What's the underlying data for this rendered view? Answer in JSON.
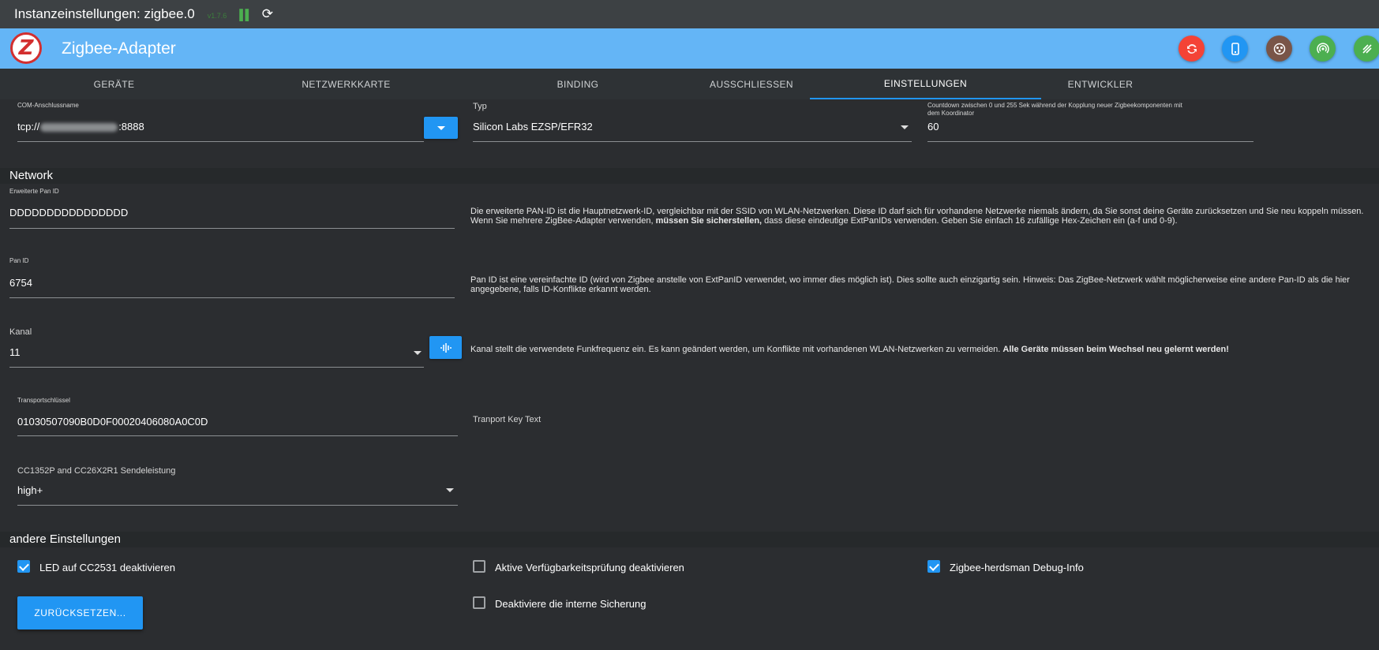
{
  "window": {
    "title": "Instanzeinstellungen: zigbee.0",
    "version": "v1.7.6"
  },
  "app": {
    "title": "Zigbee-Adapter",
    "logo_letter": "Z",
    "action_buttons": [
      {
        "icon": "sync-icon",
        "color": "#f44336"
      },
      {
        "icon": "device-icon",
        "color": "#2196f3"
      },
      {
        "icon": "group-icon",
        "color": "#795548"
      },
      {
        "icon": "pairing-icon",
        "color": "#4caf50"
      },
      {
        "icon": "signal-icon",
        "color": "#4caf50"
      }
    ]
  },
  "tabs": [
    {
      "label": "GERÄTE"
    },
    {
      "label": "NETZWERKKARTE"
    },
    {
      "label": "BINDING"
    },
    {
      "label": "AUSSCHLIESSEN"
    },
    {
      "label": "EINSTELLUNGEN",
      "active": true
    },
    {
      "label": "ENTWICKLER"
    }
  ],
  "top_fields": {
    "com": {
      "label": "COM-Anschlussname",
      "value_prefix": "tcp://",
      "value_suffix": ":8888"
    },
    "type": {
      "label": "Typ",
      "value": "Silicon Labs EZSP/EFR32"
    },
    "countdown": {
      "label": "Countdown zwischen 0 und 255 Sek während der Kopplung neuer Zigbeekomponenten mit dem Koordinator",
      "value": "60"
    }
  },
  "network": {
    "title": "Network",
    "ext_pan_id": {
      "label": "Erweiterte Pan ID",
      "value": "DDDDDDDDDDDDDDDD",
      "help_before": "Die erweiterte PAN-ID ist die Hauptnetzwerk-ID, vergleichbar mit der SSID von WLAN-Netzwerken. Diese ID darf sich für vorhandene Netzwerke niemals ändern, da Sie sonst deine Geräte zurücksetzen und Sie neu koppeln müssen. Wenn Sie mehrere ZigBee-Adapter verwenden, ",
      "help_bold": "müssen Sie sicherstellen,",
      "help_after": " dass diese eindeutige ExtPanIDs verwenden. Geben Sie einfach 16 zufällige Hex-Zeichen ein (a-f und 0-9)."
    },
    "pan_id": {
      "label": "Pan ID",
      "value": "6754",
      "help": "Pan ID ist eine vereinfachte ID (wird von Zigbee anstelle von ExtPanID verwendet, wo immer dies möglich ist). Dies sollte auch einzigartig sein. Hinweis: Das ZigBee-Netzwerk wählt möglicherweise eine andere Pan-ID als die hier angegebene, falls ID-Konflikte erkannt werden."
    },
    "channel": {
      "label": "Kanal",
      "value": "11",
      "help_before": "Kanal stellt die verwendete Funkfrequenz ein. Es kann geändert werden, um Konflikte mit vorhandenen WLAN-Netzwerken zu vermeiden. ",
      "help_bold": "Alle Geräte müssen beim Wechsel neu gelernt werden!"
    },
    "transport_key": {
      "label": "Transportschlüssel",
      "value": "01030507090B0D0F00020406080A0C0D",
      "help": "Tranport Key Text"
    },
    "tx_power": {
      "label": "CC1352P and CC26X2R1 Sendeleistung",
      "value": "high+"
    }
  },
  "other": {
    "title": "andere Einstellungen",
    "led": {
      "label": "LED auf CC2531 deaktivieren",
      "checked": true
    },
    "availability": {
      "label": "Aktive Verfügbarkeitsprüfung deaktivieren",
      "checked": false
    },
    "debug": {
      "label": "Zigbee-herdsman Debug-Info",
      "checked": true
    },
    "backup": {
      "label": "Deaktiviere die interne Sicherung",
      "checked": false
    },
    "reset_label": "ZURÜCKSETZEN..."
  }
}
